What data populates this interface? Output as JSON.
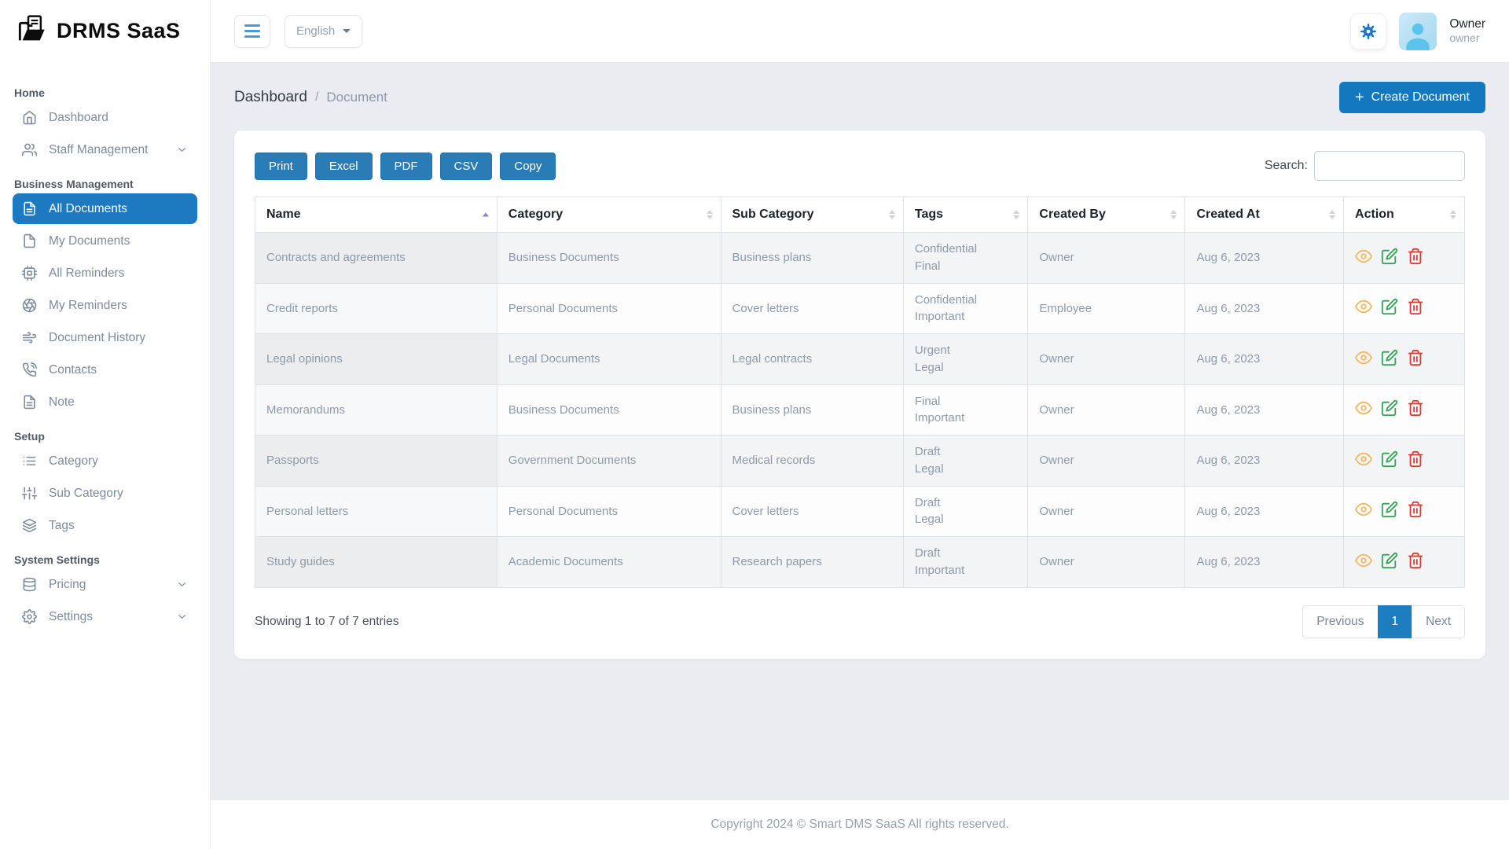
{
  "app": {
    "brand": "DRMS SaaS"
  },
  "topbar": {
    "language": "English",
    "user": {
      "name": "Owner",
      "role": "owner"
    }
  },
  "sidebar": {
    "sections": [
      {
        "label": "Home",
        "items": [
          {
            "label": "Dashboard"
          },
          {
            "label": "Staff Management"
          }
        ]
      },
      {
        "label": "Business Management",
        "items": [
          {
            "label": "All Documents"
          },
          {
            "label": "My Documents"
          },
          {
            "label": "All Reminders"
          },
          {
            "label": "My Reminders"
          },
          {
            "label": "Document History"
          },
          {
            "label": "Contacts"
          },
          {
            "label": "Note"
          }
        ]
      },
      {
        "label": "Setup",
        "items": [
          {
            "label": "Category"
          },
          {
            "label": "Sub Category"
          },
          {
            "label": "Tags"
          }
        ]
      },
      {
        "label": "System Settings",
        "items": [
          {
            "label": "Pricing"
          },
          {
            "label": "Settings"
          }
        ]
      }
    ]
  },
  "breadcrumb": {
    "primary": "Dashboard",
    "separator": "/",
    "current": "Document"
  },
  "page_actions": {
    "create_label": "Create Document",
    "create_plus": "+"
  },
  "toolbar": {
    "buttons": {
      "print": "Print",
      "excel": "Excel",
      "pdf": "PDF",
      "csv": "CSV",
      "copy": "Copy"
    },
    "search_label": "Search:",
    "search_value": ""
  },
  "table": {
    "columns": [
      {
        "label": "Name",
        "sorted": "asc"
      },
      {
        "label": "Category"
      },
      {
        "label": "Sub Category"
      },
      {
        "label": "Tags"
      },
      {
        "label": "Created By"
      },
      {
        "label": "Created At"
      },
      {
        "label": "Action"
      }
    ],
    "rows": [
      {
        "name": "Contracts and agreements",
        "category": "Business Documents",
        "sub_category": "Business plans",
        "tags": [
          "Confidential",
          "Final"
        ],
        "created_by": "Owner",
        "created_at": "Aug 6, 2023"
      },
      {
        "name": "Credit reports",
        "category": "Personal Documents",
        "sub_category": "Cover letters",
        "tags": [
          "Confidential",
          "Important"
        ],
        "created_by": "Employee",
        "created_at": "Aug 6, 2023"
      },
      {
        "name": "Legal opinions",
        "category": "Legal Documents",
        "sub_category": "Legal contracts",
        "tags": [
          "Urgent",
          "Legal"
        ],
        "created_by": "Owner",
        "created_at": "Aug 6, 2023"
      },
      {
        "name": "Memorandums",
        "category": "Business Documents",
        "sub_category": "Business plans",
        "tags": [
          "Final",
          "Important"
        ],
        "created_by": "Owner",
        "created_at": "Aug 6, 2023"
      },
      {
        "name": "Passports",
        "category": "Government Documents",
        "sub_category": "Medical records",
        "tags": [
          "Draft",
          "Legal"
        ],
        "created_by": "Owner",
        "created_at": "Aug 6, 2023"
      },
      {
        "name": "Personal letters",
        "category": "Personal Documents",
        "sub_category": "Cover letters",
        "tags": [
          "Draft",
          "Legal"
        ],
        "created_by": "Owner",
        "created_at": "Aug 6, 2023"
      },
      {
        "name": "Study guides",
        "category": "Academic Documents",
        "sub_category": "Research papers",
        "tags": [
          "Draft",
          "Important"
        ],
        "created_by": "Owner",
        "created_at": "Aug 6, 2023"
      }
    ],
    "summary": "Showing 1 to 7 of 7 entries"
  },
  "pagination": {
    "previous": "Previous",
    "page": "1",
    "next": "Next"
  },
  "footer": {
    "copyright": "Copyright 2024 © Smart DMS SaaS All rights reserved."
  },
  "colors": {
    "primary_blue": "#1878bf",
    "toolbar_button_blue": "#2a7cb7",
    "active_sidebar_blue": "#1d79c0",
    "view_icon": "#f3b760",
    "edit_icon": "#35a356",
    "delete_icon": "#da3b31",
    "content_background": "#eaecf1"
  }
}
